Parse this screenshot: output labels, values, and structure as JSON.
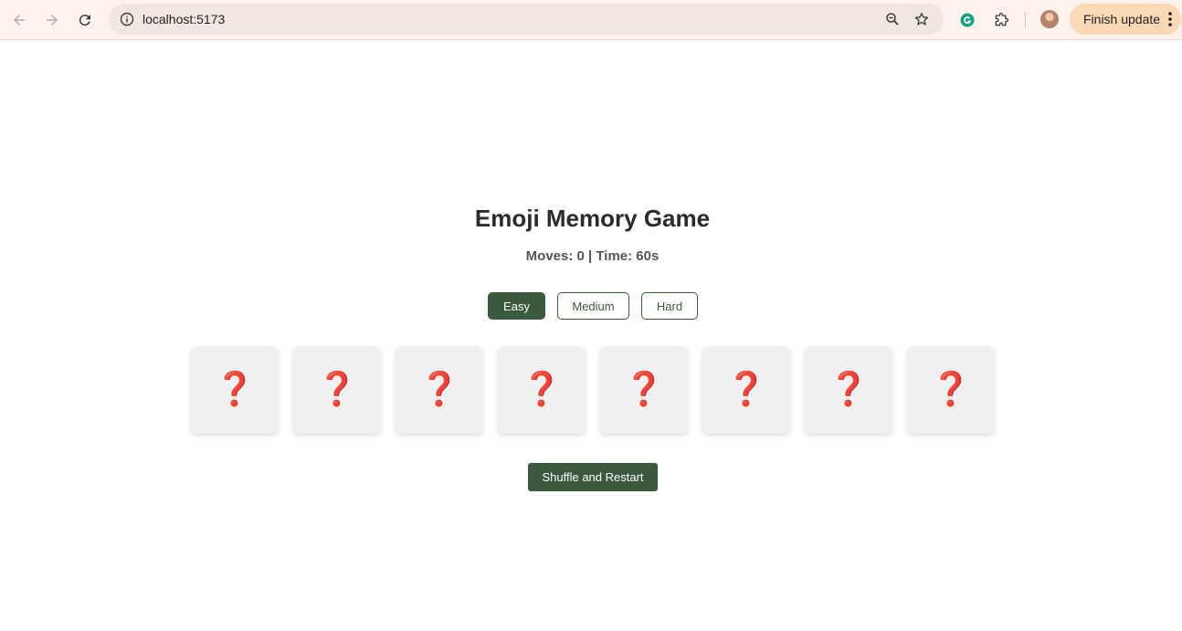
{
  "browser": {
    "url": "localhost:5173",
    "finish_update_label": "Finish update"
  },
  "game": {
    "title": "Emoji Memory Game",
    "stats": "Moves: 0 | Time: 60s",
    "difficulties": [
      {
        "label": "Easy",
        "selected": true
      },
      {
        "label": "Medium",
        "selected": false
      },
      {
        "label": "Hard",
        "selected": false
      }
    ],
    "cards": [
      "❓",
      "❓",
      "❓",
      "❓",
      "❓",
      "❓",
      "❓",
      "❓"
    ],
    "restart_label": "Shuffle and Restart"
  },
  "colors": {
    "accent": "#3b5a3d",
    "card_back": "#f0f0f0",
    "question_mark": "#dd3b35"
  }
}
